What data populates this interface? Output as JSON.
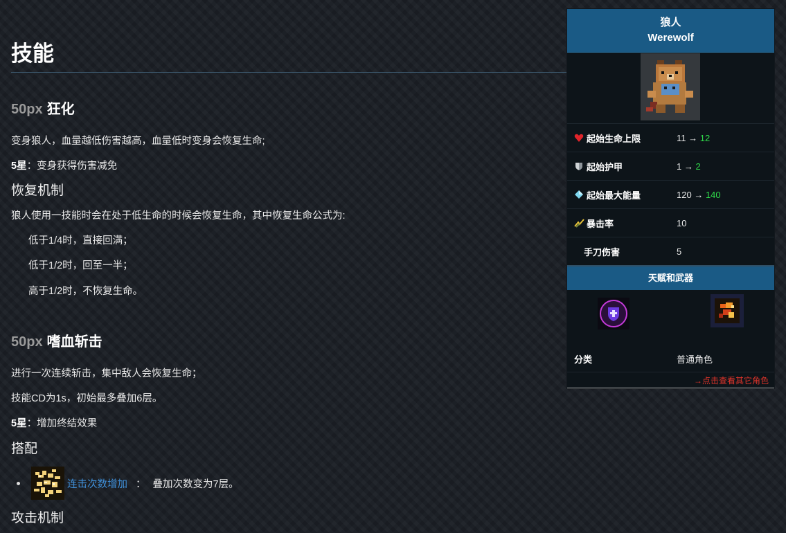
{
  "main": {
    "title": "技能",
    "skills": [
      {
        "size": "50px",
        "name": "狂化",
        "desc": "变身狼人，血量越低伤害越高，血量低时变身会恢复生命;",
        "star5_label": "5星",
        "star5_text": "：变身获得伤害减免",
        "sub_heading": "恢复机制",
        "mech_intro": "狼人使用一技能时会在处于低生命的时候会恢复生命，其中恢复生命公式为:",
        "mech_lines": [
          "低于1/4时，直接回满；",
          "低于1/2时，回至一半；",
          "高于1/2时，不恢复生命。"
        ]
      },
      {
        "size": "50px",
        "name": "嗜血斩击",
        "desc": "进行一次连续斩击，集中敌人会恢复生命；",
        "cd_text": "技能CD为1s，初始最多叠加6层。",
        "star5_label": "5星",
        "star5_text": "：增加终结效果",
        "combo_heading": "搭配",
        "combo_link": "连击次数增加",
        "combo_sep": "：",
        "combo_desc": "叠加次数变为7层。",
        "attack_heading": "攻击机制"
      }
    ]
  },
  "infobox": {
    "name_cn": "狼人",
    "name_en": "Werewolf",
    "stats": [
      {
        "icon": "heart-icon",
        "label": "起始生命上限",
        "base": "11",
        "arrow": "→",
        "up": "12"
      },
      {
        "icon": "shield-icon",
        "label": "起始护甲",
        "base": "1",
        "arrow": "→",
        "up": "2"
      },
      {
        "icon": "diamond-icon",
        "label": "起始最大能量",
        "base": "120",
        "arrow": "→",
        "up": "140"
      },
      {
        "icon": "crit-icon",
        "label": "暴击率",
        "base": "10",
        "arrow": "",
        "up": ""
      },
      {
        "icon": "",
        "label": "手刀伤害",
        "base": "5",
        "arrow": "",
        "up": ""
      }
    ],
    "talents_heading": "天赋和武器",
    "class_label": "分类",
    "class_value": "普通角色",
    "more_link": "→点击查看其它角色"
  },
  "colors": {
    "accent": "#1a5a85",
    "link": "#3f8fd8",
    "upgrade": "#2fdc4a",
    "more_link": "#e0342a"
  }
}
